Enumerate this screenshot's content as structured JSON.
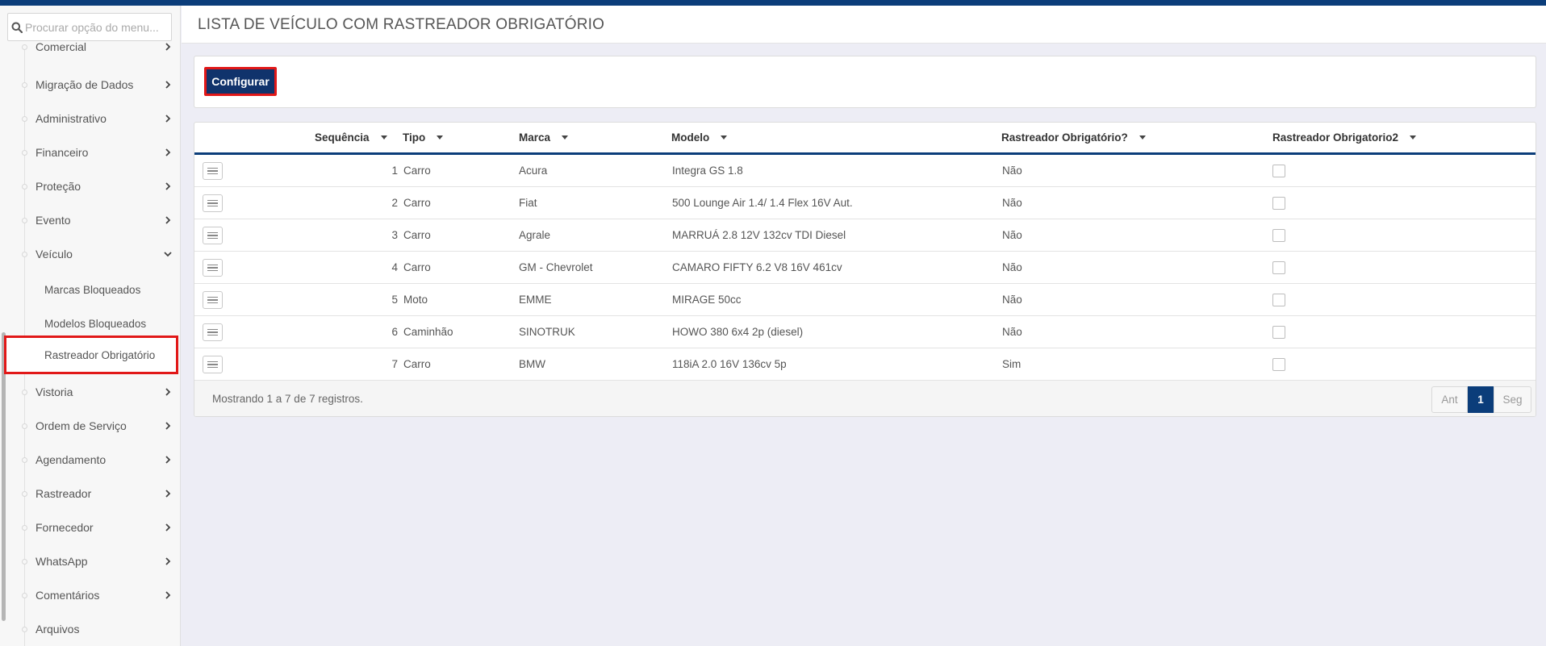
{
  "search": {
    "placeholder": "Procurar opção do menu..."
  },
  "sidebar": {
    "items": [
      {
        "label": "Comercial"
      },
      {
        "label": "Migração de Dados"
      },
      {
        "label": "Administrativo"
      },
      {
        "label": "Financeiro"
      },
      {
        "label": "Proteção"
      },
      {
        "label": "Evento"
      },
      {
        "label": "Veículo"
      },
      {
        "label": "Vistoria"
      },
      {
        "label": "Ordem de Serviço"
      },
      {
        "label": "Agendamento"
      },
      {
        "label": "Rastreador"
      },
      {
        "label": "Fornecedor"
      },
      {
        "label": "WhatsApp"
      },
      {
        "label": "Comentários"
      },
      {
        "label": "Arquivos"
      }
    ],
    "veiculo_sub": [
      {
        "label": "Marcas Bloqueados"
      },
      {
        "label": "Modelos Bloqueados"
      },
      {
        "label": "Rastreador Obrigatório"
      }
    ]
  },
  "page": {
    "title": "LISTA DE VEÍCULO COM RASTREADOR OBRIGATÓRIO"
  },
  "toolbar": {
    "configure_label": "Configurar"
  },
  "table": {
    "headers": {
      "sequencia": "Sequência",
      "tipo": "Tipo",
      "marca": "Marca",
      "modelo": "Modelo",
      "obrigatorio": "Rastreador Obrigatório?",
      "obrigatorio2": "Rastreador Obrigatorio2"
    },
    "rows": [
      {
        "seq": "1",
        "tipo": "Carro",
        "marca": "Acura",
        "modelo": "Integra GS 1.8",
        "obrigatorio": "Não"
      },
      {
        "seq": "2",
        "tipo": "Carro",
        "marca": "Fiat",
        "modelo": "500 Lounge Air 1.4/ 1.4 Flex 16V Aut.",
        "obrigatorio": "Não"
      },
      {
        "seq": "3",
        "tipo": "Carro",
        "marca": "Agrale",
        "modelo": "MARRUÁ 2.8 12V 132cv TDI Diesel",
        "obrigatorio": "Não"
      },
      {
        "seq": "4",
        "tipo": "Carro",
        "marca": "GM - Chevrolet",
        "modelo": "CAMARO FIFTY 6.2 V8 16V 461cv",
        "obrigatorio": "Não"
      },
      {
        "seq": "5",
        "tipo": "Moto",
        "marca": "EMME",
        "modelo": "MIRAGE 50cc",
        "obrigatorio": "Não"
      },
      {
        "seq": "6",
        "tipo": "Caminhão",
        "marca": "SINOTRUK",
        "modelo": "HOWO 380 6x4 2p (diesel)",
        "obrigatorio": "Não"
      },
      {
        "seq": "7",
        "tipo": "Carro",
        "marca": "BMW",
        "modelo": "118iA 2.0 16V 136cv 5p",
        "obrigatorio": "Sim"
      }
    ],
    "footer_info": "Mostrando 1 a 7 de 7 registros.",
    "pagination": {
      "prev": "Ant",
      "current": "1",
      "next": "Seg"
    }
  },
  "colors": {
    "accent": "#0b3d7a",
    "button": "#10336c",
    "highlight": "#e11818"
  },
  "icons": {
    "search": "search-icon",
    "chevron": "chevron-right-icon",
    "row_menu": "menu-lines-icon"
  }
}
